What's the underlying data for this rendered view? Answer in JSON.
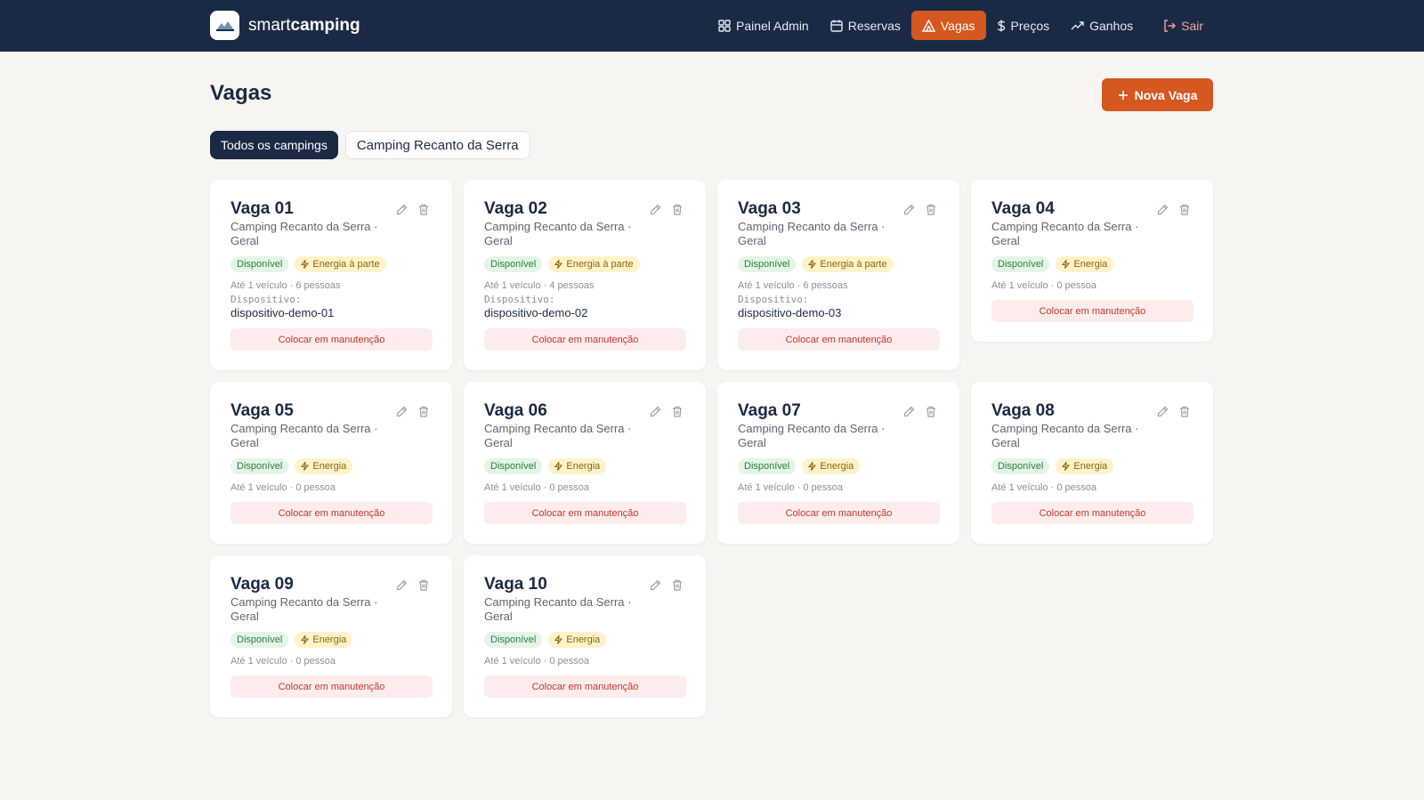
{
  "brand": {
    "name_light": "smart",
    "name_bold": "camping"
  },
  "nav": [
    {
      "label": "Painel Admin",
      "icon": "grid-icon"
    },
    {
      "label": "Reservas",
      "icon": "calendar-icon"
    },
    {
      "label": "Vagas",
      "icon": "tent-icon"
    },
    {
      "label": "Preços",
      "icon": "dollar-icon"
    },
    {
      "label": "Ganhos",
      "icon": "trending-icon"
    },
    {
      "label": "Sair",
      "icon": "logout-icon"
    }
  ],
  "page": {
    "title": "Vagas",
    "new_button": "Nova Vaga"
  },
  "filters": [
    {
      "label": "Todos os campings",
      "selected": true
    },
    {
      "label": "Camping Recanto da Serra",
      "selected": false
    }
  ],
  "colors": {
    "navy": "#1b2a44",
    "accent": "#d4581f",
    "available": "#2e7d3a",
    "danger": "#c0392b"
  },
  "cards": [
    {
      "title": "Vaga 01",
      "sub1": "Camping Recanto da Serra ·",
      "sub2": "Geral",
      "status": "Disponível",
      "energy": "Energia à parte",
      "capacity": "Até 1 veículo · 6 pessoas",
      "device_label": "Dispositivo:",
      "device": "dispositivo-demo-01",
      "action": "Colocar em manutenção"
    },
    {
      "title": "Vaga 02",
      "sub1": "Camping Recanto da Serra ·",
      "sub2": "Geral",
      "status": "Disponível",
      "energy": "Energia à parte",
      "capacity": "Até 1 veículo · 4 pessoas",
      "device_label": "Dispositivo:",
      "device": "dispositivo-demo-02",
      "action": "Colocar em manutenção"
    },
    {
      "title": "Vaga 03",
      "sub1": "Camping Recanto da Serra ·",
      "sub2": "Geral",
      "status": "Disponível",
      "energy": "Energia à parte",
      "capacity": "Até 1 veículo · 6 pessoas",
      "device_label": "Dispositivo:",
      "device": "dispositivo-demo-03",
      "action": "Colocar em manutenção"
    },
    {
      "title": "Vaga 04",
      "sub1": "Camping Recanto da Serra ·",
      "sub2": "Geral",
      "status": "Disponível",
      "energy": "Energia",
      "capacity": "Até 1 veículo · 0 pessoa",
      "action": "Colocar em manutenção"
    },
    {
      "title": "Vaga 05",
      "sub1": "Camping Recanto da Serra ·",
      "sub2": "Geral",
      "status": "Disponível",
      "energy": "Energia",
      "capacity": "Até 1 veículo · 0 pessoa",
      "action": "Colocar em manutenção"
    },
    {
      "title": "Vaga 06",
      "sub1": "Camping Recanto da Serra ·",
      "sub2": "Geral",
      "status": "Disponível",
      "energy": "Energia",
      "capacity": "Até 1 veículo · 0 pessoa",
      "action": "Colocar em manutenção"
    },
    {
      "title": "Vaga 07",
      "sub1": "Camping Recanto da Serra ·",
      "sub2": "Geral",
      "status": "Disponível",
      "energy": "Energia",
      "capacity": "Até 1 veículo · 0 pessoa",
      "action": "Colocar em manutenção"
    },
    {
      "title": "Vaga 08",
      "sub1": "Camping Recanto da Serra ·",
      "sub2": "Geral",
      "status": "Disponível",
      "energy": "Energia",
      "capacity": "Até 1 veículo · 0 pessoa",
      "action": "Colocar em manutenção"
    },
    {
      "title": "Vaga 09",
      "sub1": "Camping Recanto da Serra ·",
      "sub2": "Geral",
      "status": "Disponível",
      "energy": "Energia",
      "capacity": "Até 1 veículo · 0 pessoa",
      "action": "Colocar em manutenção"
    },
    {
      "title": "Vaga 10",
      "sub1": "Camping Recanto da Serra ·",
      "sub2": "Geral",
      "status": "Disponível",
      "energy": "Energia",
      "capacity": "Até 1 veículo · 0 pessoa",
      "action": "Colocar em manutenção"
    }
  ]
}
